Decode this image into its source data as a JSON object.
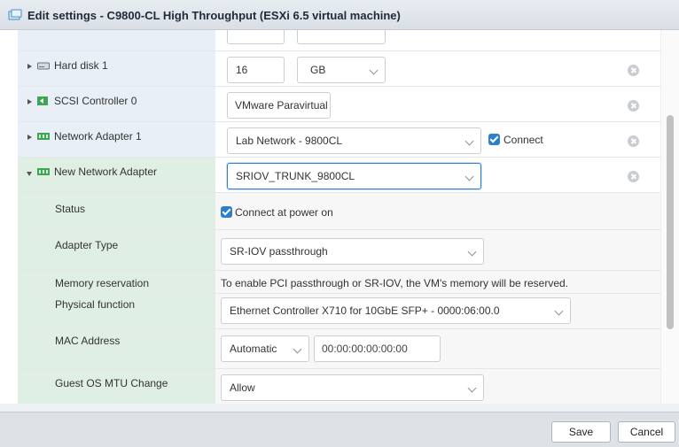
{
  "window": {
    "title": "Edit settings - C9800-CL High Throughput (ESXi 6.5 virtual machine)"
  },
  "devices": {
    "hard_disk": {
      "label": "Hard disk 1",
      "size_value": "16",
      "size_unit": "GB"
    },
    "scsi": {
      "label": "SCSI Controller 0",
      "type_value": "VMware Paravirtual"
    },
    "network_adapter_1": {
      "label": "Network Adapter 1",
      "network": "Lab Network - 9800CL",
      "connect_label": "Connect"
    },
    "new_network_adapter": {
      "label": "New Network Adapter",
      "network": "SRIOV_TRUNK_9800CL",
      "status": {
        "label": "Status",
        "checkbox_label": "Connect at power on"
      },
      "adapter_type": {
        "label": "Adapter Type",
        "value": "SR-IOV passthrough"
      },
      "memory_reservation": {
        "label": "Memory reservation",
        "text": "To enable PCI passthrough or SR-IOV, the VM's memory will be reserved."
      },
      "physical_function": {
        "label": "Physical function",
        "value": "Ethernet Controller X710 for 10GbE SFP+ - 0000:06:00.0"
      },
      "mac_address": {
        "label": "MAC Address",
        "mode": "Automatic",
        "value": "00:00:00:00:00:00"
      },
      "guest_os_mtu": {
        "label": "Guest OS MTU Change",
        "value": "Allow"
      }
    }
  },
  "footer": {
    "save_label": "Save",
    "cancel_label": "Cancel"
  },
  "colors": {
    "accent": "#2d7fce",
    "device_row_bg": "#e8eff6",
    "expanded_row_bg": "#e0efe4"
  },
  "icons": [
    "vm-window-icon",
    "hard-disk-icon",
    "scsi-controller-icon",
    "network-adapter-icon",
    "remove-icon"
  ]
}
